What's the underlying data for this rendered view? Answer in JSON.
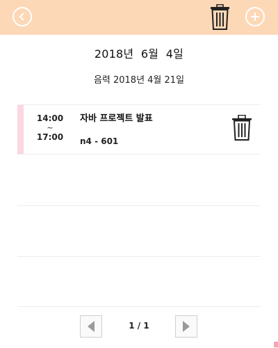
{
  "topbar": {
    "back_icon": "chevron-left-circle-icon",
    "delete_icon": "trash-icon",
    "add_icon": "plus-circle-icon",
    "background_color": "#fdd8b6"
  },
  "date": {
    "solar": "2018년  6월  4일",
    "lunar": "음력 2018년 4월 21일"
  },
  "events": [
    {
      "start": "14:00",
      "separator": "~",
      "end": "17:00",
      "title": "자바 프로젝트 발표",
      "room": "n4 - 601",
      "accent_color": "#fcd6e0",
      "delete_icon": "trash-icon"
    }
  ],
  "pagination": {
    "label": "1 / 1",
    "prev_icon": "triangle-left-icon",
    "next_icon": "triangle-right-icon"
  }
}
